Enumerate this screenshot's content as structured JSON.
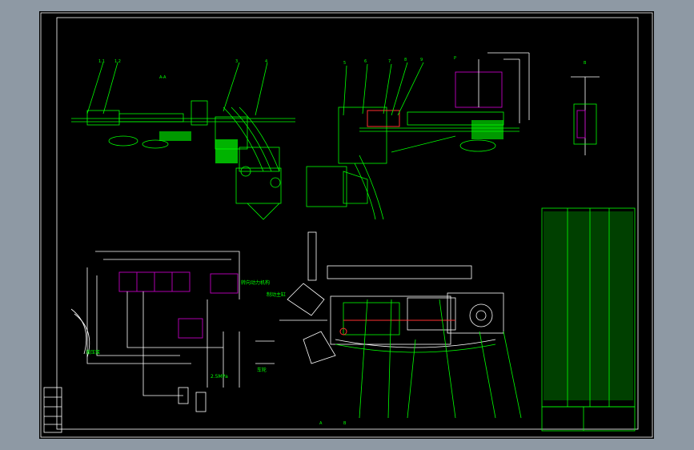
{
  "colors": {
    "background": "#8e99a4",
    "paper": "#000000",
    "lines": "#00ff00",
    "frame": "#ffffff",
    "valve": "#c000c0"
  },
  "labels": {
    "main_valve": "转向动力机构",
    "brake_valve": "制动主缸",
    "pump": "液压泵",
    "wheel": "车轮",
    "pressure": "2.5MPa",
    "top_left_note": "A-A",
    "pin_a": "A",
    "pin_b": "B"
  }
}
